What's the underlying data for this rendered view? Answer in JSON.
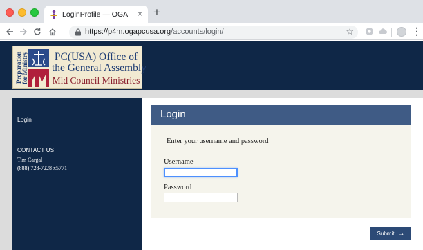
{
  "browser": {
    "tab_title": "LoginProfile — OGA",
    "tab_close": "×",
    "new_tab": "+",
    "url_host": "https://p4m.ogapcusa.org",
    "url_path": "/accounts/login/",
    "icons": [
      "back-arrow-icon",
      "forward-arrow-icon",
      "reload-icon",
      "home-icon",
      "lock-icon",
      "star-icon",
      "extension-icon",
      "cloud-extension-icon",
      "profile-icon",
      "menu-icon"
    ]
  },
  "logo": {
    "vertical_text": [
      "Preparation",
      "for Ministry"
    ],
    "line1": "PC(USA) Office of",
    "line2": "the General Assembly",
    "line3": "Mid Council Ministries"
  },
  "sidebar": {
    "login_link": "Login",
    "contact_heading": "CONTACT US",
    "contact_name": "Tim Cargal",
    "contact_phone": "(888) 728-7228 x5771"
  },
  "login": {
    "title": "Login",
    "instruction": "Enter your username and password",
    "username_label": "Username",
    "username_value": "",
    "password_label": "Password",
    "password_value": "",
    "submit_label": "Submit",
    "submit_arrow": "→"
  },
  "colors": {
    "navy": "#0f2747",
    "login_header": "#3f5b85",
    "submit": "#2c4a76",
    "panel": "#f5f4ec",
    "logo_bg": "#f2ead2",
    "logo_blue": "#1f3d74",
    "logo_red": "#8a1f2e"
  }
}
